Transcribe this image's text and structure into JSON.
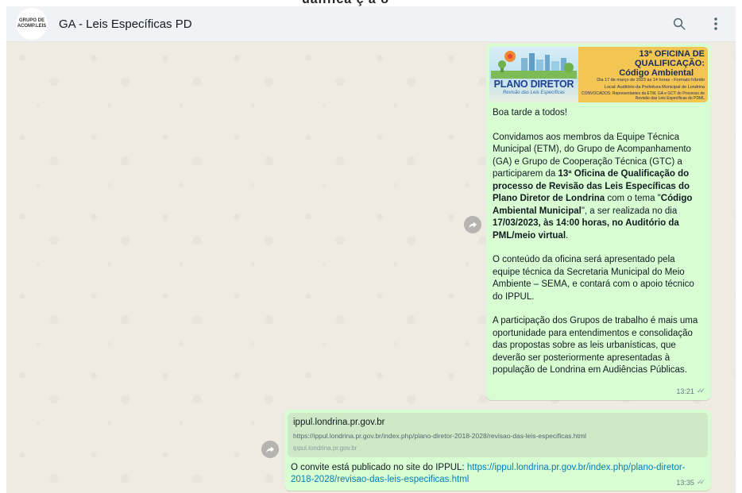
{
  "header": {
    "avatar_text_line1": "GRUPO DE",
    "avatar_text_line2": "ACOMP.LEIS",
    "title": "GA - Leis Específicas PD",
    "search_icon": "search-icon",
    "menu_icon": "kebab-menu-icon"
  },
  "cutoff_text": "ualifica ç ã o",
  "message1": {
    "banner": {
      "logo_title": "PLANO DIRETOR",
      "logo_subtitle": "Revisão das Leis Específicas",
      "heading1": "13ª OFICINA DE QUALIFICAÇÃO:",
      "heading2": "Código Ambiental",
      "date_line": "Dia 17 de março de 2023 às 14 horas - Formato híbrido",
      "location_line": "Local: Auditório da Prefeitura Municipal de Londrina",
      "convocados_line": "CONVOCADOS: Representantes da ETM, GA e GCT do Processo de Revisão das Leis Específicas do PDML"
    },
    "greeting": "Boa tarde a todos!",
    "p2_part1": "Convidamos aos membros da Equipe Técnica Municipal (ETM), do Grupo de Acompanhamento (GA) e Grupo de Cooperação Técnica (GTC) a participarem da ",
    "p2_bold1": "13ª Oficina de Qualificação do processo de Revisão das Leis Específicas do Plano Diretor de Londrina",
    "p2_part2": " com o tema \"",
    "p2_bold2": "Código Ambiental Municipal",
    "p2_part3": "\", a ser realizada no dia ",
    "p2_bold3": "17/03/2023, às 14:00 horas, no Auditório da PML/meio virtual",
    "p2_part4": ".",
    "p3": "O conteúdo da oficina será apresentado pela equipe técnica da Secretaria Municipal do Meio Ambiente – SEMA, e contará com o apoio técnico do IPPUL.",
    "p4": "A participação dos Grupos de trabalho é mais uma oportunidade para entendimentos e consolidação das propostas sobre as leis urbanísticas, que deverão ser posteriormente apresentadas à população de Londrina em Audiências Públicas.",
    "time": "13:21"
  },
  "message2": {
    "preview_title": "ippul.londrina.pr.gov.br",
    "preview_url": "https://ippul.londrina.pr.gov.br/index.php/plano-diretor-2018-2028/revisao-das-leis-especificas.html",
    "preview_domain": "ippul.londrina.pr.gov.br",
    "text_prefix": "O convite está publicado no site do IPPUL: ",
    "link": "https://ippul.londrina.pr.gov.br/index.php/plano-diretor-2018-2028/revisao-das-leis-especificas.html",
    "time": "13:35"
  },
  "colors": {
    "outgoing_bubble": "#d9fdd3",
    "chat_bg": "#efeae2",
    "link": "#027eb5",
    "banner_yellow": "#f3c552",
    "logo_blue": "#1f3f93"
  }
}
